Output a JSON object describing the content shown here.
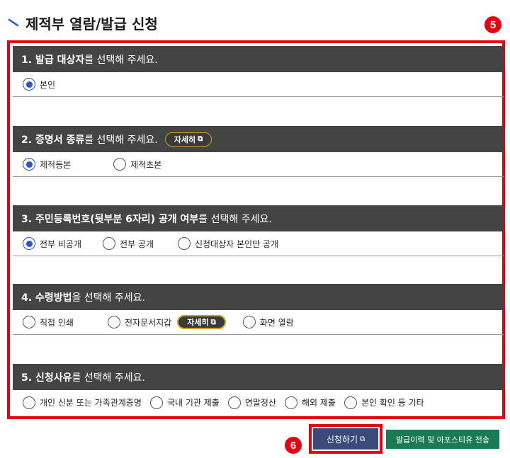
{
  "page": {
    "title": "제적부 열람/발급 신청"
  },
  "badges": {
    "b5": "5",
    "b6": "6"
  },
  "sections": {
    "s1": {
      "bold": "1. 발급 대상자",
      "rest": "를 선택해 주세요.",
      "options": [
        "본인"
      ],
      "selected": 0
    },
    "s2": {
      "bold": "2. 증명서 종류",
      "rest": "를 선택해 주세요.",
      "detail_label": "자세히",
      "options": [
        "제적등본",
        "제적초본"
      ],
      "selected": 0
    },
    "s3": {
      "bold": "3. 주민등록번호(뒷부분 6자리) 공개 여부",
      "rest": "를 선택해 주세요.",
      "options": [
        "전부 비공개",
        "전부 공개",
        "신청대상자 본인만 공개"
      ],
      "selected": 0
    },
    "s4": {
      "bold": "4. 수령방법",
      "rest": "을 선택해 주세요.",
      "detail_label": "자세히",
      "options": [
        "직접 인쇄",
        "전자문서지갑",
        "화면 열람"
      ],
      "selected": -1
    },
    "s5": {
      "bold": "5. 신청사유",
      "rest": "를 선택해 주세요.",
      "options": [
        "개인 신분 또는 가족관계증명",
        "국내 기관 제출",
        "연말정산",
        "해외 제출",
        "본인 확인 등 기타"
      ],
      "selected": -1
    }
  },
  "buttons": {
    "apply": "신청하기",
    "history": "발급이력 및 아포스티유 전송"
  },
  "icons": {
    "external": "external-link-icon",
    "title_mark": "title-mark-icon"
  },
  "colors": {
    "highlight": "#e60012",
    "header_bg": "#444444",
    "radio_selected": "#2b56c6",
    "apply_bg": "#3b4a78",
    "history_bg": "#1a7a55",
    "detail_border": "#c9a227"
  }
}
